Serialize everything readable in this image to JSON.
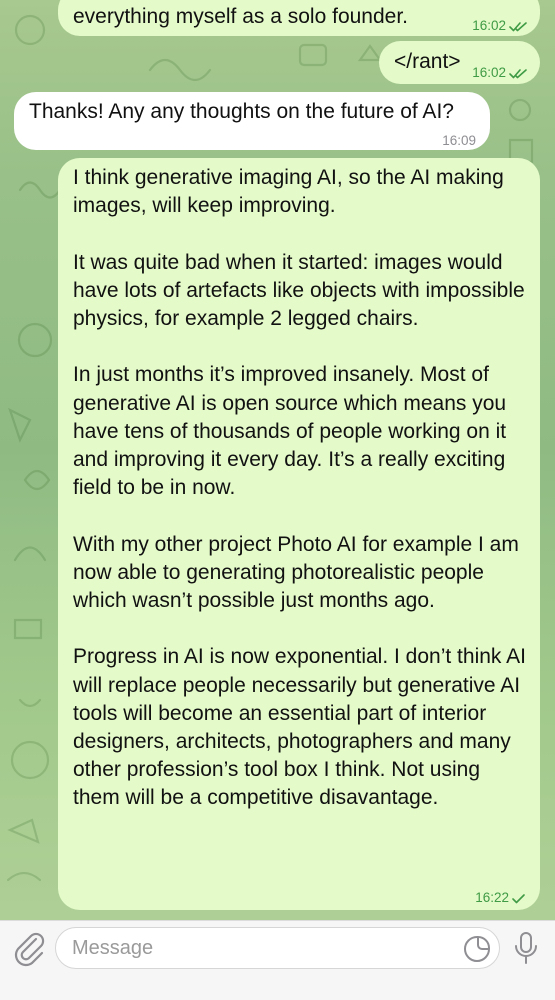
{
  "messages": [
    {
      "id": "m1",
      "direction": "outgoing",
      "text": "everything myself as a solo founder.",
      "time": "16:02",
      "status": "read"
    },
    {
      "id": "m2",
      "direction": "outgoing",
      "text": "</rant>",
      "time": "16:02",
      "status": "read"
    },
    {
      "id": "m3",
      "direction": "incoming",
      "text": "Thanks! Any any thoughts on the future of AI?",
      "time": "16:09"
    },
    {
      "id": "m4",
      "direction": "outgoing",
      "paragraphs": [
        "I think generative imaging AI, so the AI making images, will keep improving.",
        "It was quite bad when it started: images would have lots of artefacts like objects with impossible physics, for example 2 legged chairs.",
        "In just months it’s improved insanely. Most of generative AI is open source which means you have tens of thousands of people working on it and improving it every day. It’s a really exciting field to be in now.",
        "With my other project Photo AI for example I am now able to generating photorealistic people which wasn’t possible just months ago.",
        "Progress in AI is now exponential. I don’t think AI will replace people necessarily but generative AI tools will become an essential part of interior designers, architects, photographers and many other profession’s tool box I think. Not using them will be a competitive disavantage."
      ],
      "time": "16:22",
      "status": "sent"
    }
  ],
  "composer": {
    "placeholder": "Message"
  },
  "icons": {
    "attach": "paperclip-icon",
    "sticker": "sticker-icon",
    "mic": "microphone-icon",
    "read": "double-check-icon",
    "sent": "single-check-icon"
  },
  "colors": {
    "outgoing_bubble": "#e4fac9",
    "incoming_bubble": "#ffffff",
    "outgoing_meta": "#3f9b45",
    "incoming_meta": "#8e8e93",
    "chat_background": "#98c088"
  }
}
